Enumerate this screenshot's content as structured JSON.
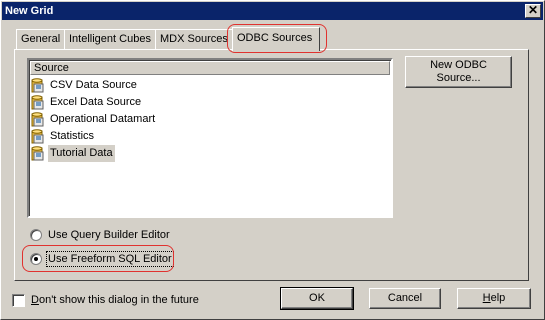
{
  "window": {
    "title": "New Grid",
    "close_glyph": "✕"
  },
  "tabs": [
    {
      "label": "General",
      "active": false
    },
    {
      "label": "Intelligent Cubes",
      "active": false
    },
    {
      "label": "MDX Sources",
      "active": false
    },
    {
      "label": "ODBC Sources",
      "active": true
    }
  ],
  "source_list": {
    "header": "Source",
    "icon": "database-icon",
    "items": [
      {
        "label": "CSV Data Source",
        "selected": false
      },
      {
        "label": "Excel Data Source",
        "selected": false
      },
      {
        "label": "Operational Datamart",
        "selected": false
      },
      {
        "label": "Statistics",
        "selected": false
      },
      {
        "label": "Tutorial Data",
        "selected": true
      }
    ]
  },
  "new_odbc_button": {
    "line1": "New ODBC",
    "line2": "Source..."
  },
  "editor_options": [
    {
      "label": "Use Query Builder Editor",
      "checked": false
    },
    {
      "label": "Use Freeform SQL Editor",
      "checked": true
    }
  ],
  "dont_show": {
    "label_prefix": "D",
    "label_rest": "on't show this dialog in the future",
    "checked": false
  },
  "buttons": {
    "ok": "OK",
    "cancel": "Cancel",
    "help_prefix": "H",
    "help_rest": "elp"
  },
  "colors": {
    "titlebar": "#0a246a",
    "highlight": "#e0322f",
    "dialog_bg": "#d4d0c8"
  }
}
